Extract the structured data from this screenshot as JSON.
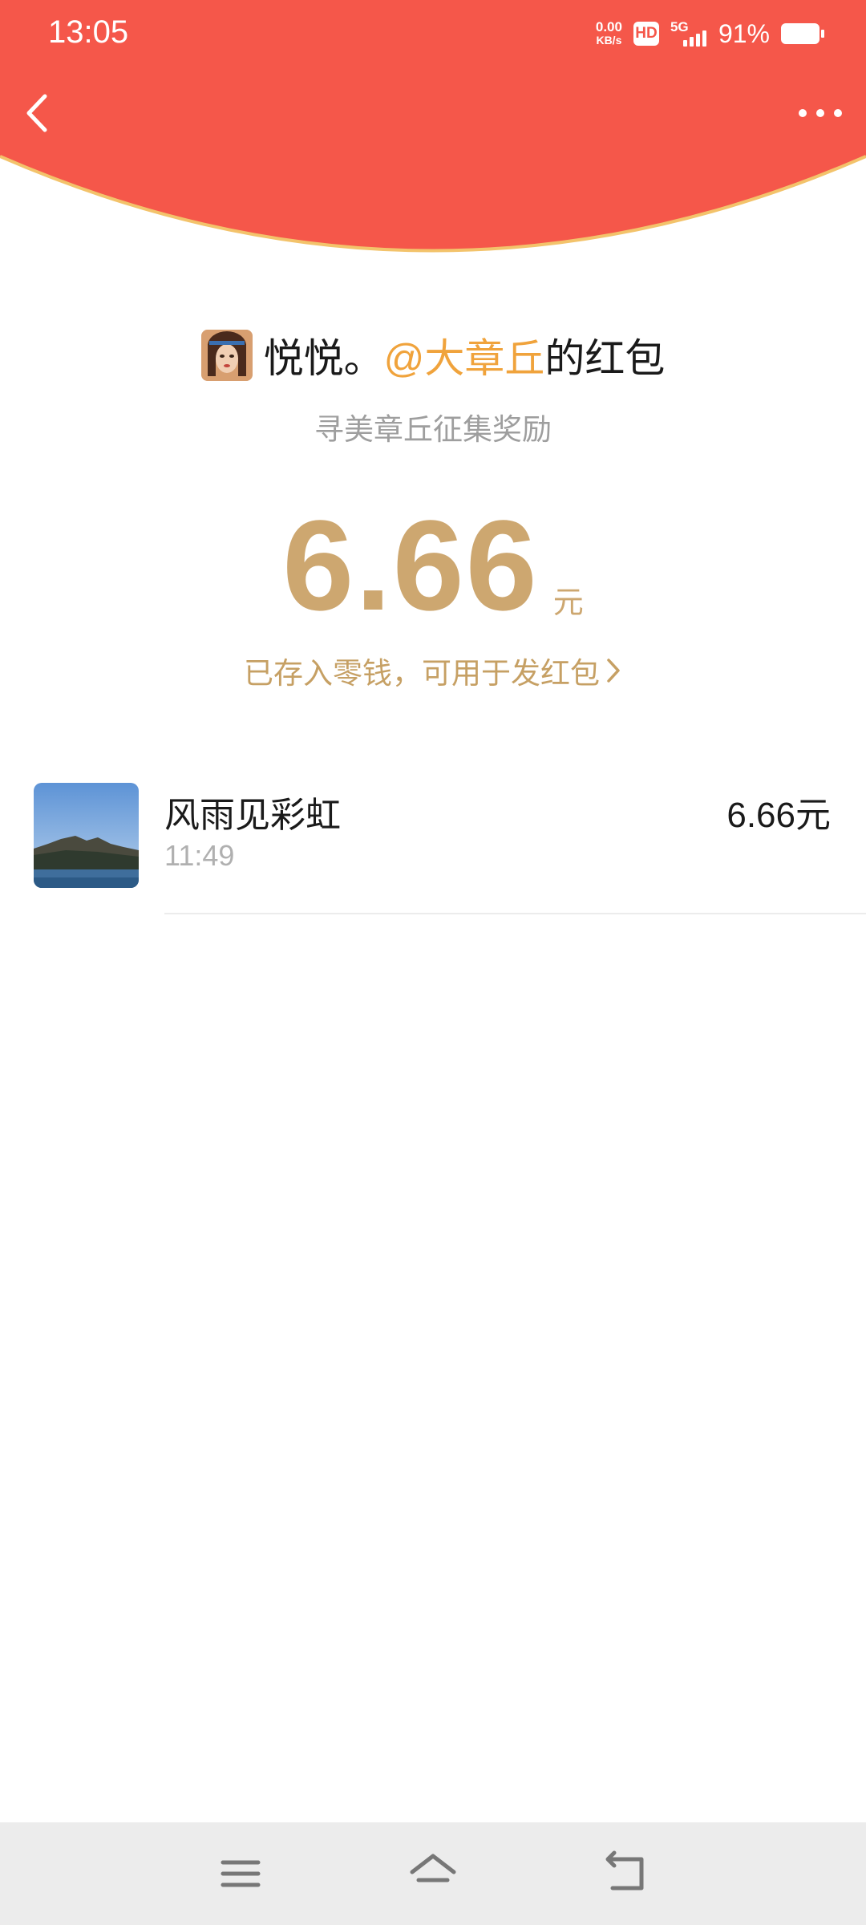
{
  "status_bar": {
    "time": "13:05",
    "net_speed_value": "0.00",
    "net_speed_unit": "KB/s",
    "hd_badge": "HD",
    "network_type": "5G",
    "battery_percent": "91%",
    "battery_level": 0.91
  },
  "header": {
    "background_color": "#f5574a",
    "arc_border_color": "#f3c36b",
    "back_icon": "chevron-left-icon",
    "more_icon": "more-horizontal-icon"
  },
  "red_packet": {
    "sender_name": "悦悦。",
    "sender_mention": "@大章丘",
    "sender_suffix": "的红包",
    "subtitle": "寻美章丘征集奖励",
    "amount": "6.66",
    "amount_unit": "元",
    "stored_text": "已存入零钱，可用于发红包",
    "accent_color": "#cda770"
  },
  "records": [
    {
      "name": "风雨见彩虹",
      "time": "11:49",
      "amount": "6.66元"
    }
  ],
  "nav_bar": {
    "menu_icon": "menu-icon",
    "home_icon": "home-icon",
    "back_icon": "back-arrow-icon"
  }
}
